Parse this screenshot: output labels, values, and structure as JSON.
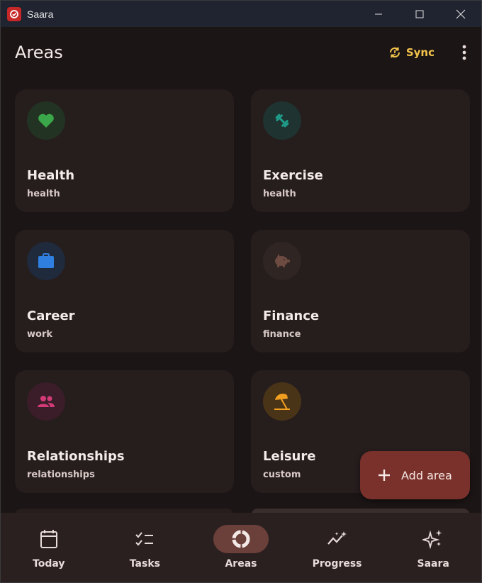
{
  "window": {
    "title": "Saara"
  },
  "header": {
    "title": "Areas",
    "sync_label": "Sync"
  },
  "areas": [
    {
      "title": "Health",
      "category": "health",
      "icon": "heart-icon",
      "icon_color": "#3aa84a",
      "circle_color": "#233323"
    },
    {
      "title": "Exercise",
      "category": "health",
      "icon": "dumbbell-icon",
      "icon_color": "#1f9c8a",
      "circle_color": "#1f3330"
    },
    {
      "title": "Career",
      "category": "work",
      "icon": "briefcase-icon",
      "icon_color": "#2f7fe0",
      "circle_color": "#1f2a3d"
    },
    {
      "title": "Finance",
      "category": "finance",
      "icon": "piggy-bank-icon",
      "icon_color": "#6d4b40",
      "circle_color": "#2f2523"
    },
    {
      "title": "Relationships",
      "category": "relationships",
      "icon": "people-icon",
      "icon_color": "#d23a78",
      "circle_color": "#3a1d28"
    },
    {
      "title": "Leisure",
      "category": "custom",
      "icon": "umbrella-beach-icon",
      "icon_color": "#f4a020",
      "circle_color": "#4a3418"
    }
  ],
  "fab": {
    "label": "Add area"
  },
  "nav": {
    "items": [
      {
        "label": "Today",
        "icon": "calendar-icon"
      },
      {
        "label": "Tasks",
        "icon": "checklist-icon"
      },
      {
        "label": "Areas",
        "icon": "donut-icon",
        "active": true
      },
      {
        "label": "Progress",
        "icon": "trend-sparkle-icon"
      },
      {
        "label": "Saara",
        "icon": "sparkles-icon"
      }
    ]
  },
  "colors": {
    "background": "#1c1515",
    "card": "#261d1d",
    "accent_sync": "#f2c44b",
    "fab": "#7a312b",
    "nav_bg": "#2a2020",
    "nav_active_pill": "#6b3f3a"
  }
}
